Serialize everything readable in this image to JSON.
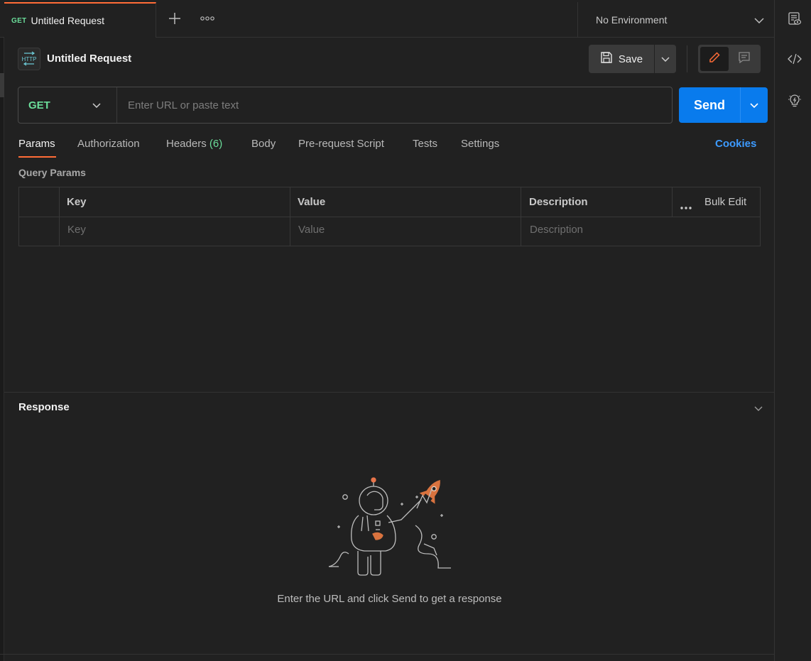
{
  "tabbar": {
    "active_tab": {
      "method": "GET",
      "name": "Untitled Request"
    }
  },
  "environment": {
    "selected": "No Environment"
  },
  "request": {
    "badge_text": "HTTP",
    "title": "Untitled Request",
    "save_label": "Save"
  },
  "url_bar": {
    "method": "GET",
    "placeholder": "Enter URL or paste text",
    "send_label": "Send"
  },
  "tabs": {
    "params": "Params",
    "authorization": "Authorization",
    "headers": "Headers",
    "headers_count": "(6)",
    "body": "Body",
    "pre_request": "Pre-request Script",
    "tests": "Tests",
    "settings": "Settings",
    "cookies": "Cookies"
  },
  "query_params": {
    "label": "Query Params",
    "columns": [
      "Key",
      "Value",
      "Description"
    ],
    "bulk_edit": "Bulk Edit",
    "placeholders": [
      "Key",
      "Value",
      "Description"
    ]
  },
  "response": {
    "title": "Response",
    "empty_message": "Enter the URL and click Send to get a response"
  },
  "colors": {
    "accent": "#ff6c37",
    "method_get": "#6bdd9a",
    "send_button": "#097bed",
    "link": "#3d9bff"
  }
}
